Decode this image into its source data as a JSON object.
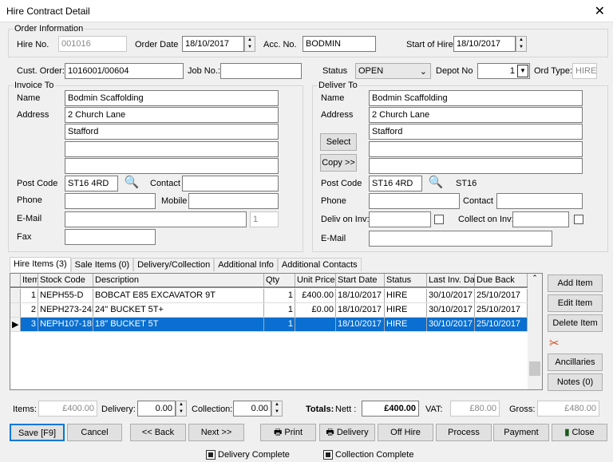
{
  "window": {
    "title": "Hire Contract Detail"
  },
  "order": {
    "group": "Order Information",
    "hire_no_label": "Hire No.",
    "hire_no": "001016",
    "order_date_label": "Order Date",
    "order_date": "18/10/2017",
    "acc_no_label": "Acc. No.",
    "acc_no": "BODMIN",
    "start_label": "Start of Hire",
    "start": "18/10/2017"
  },
  "cust": {
    "label": "Cust. Order:",
    "value": "1016001/00604",
    "job_label": "Job No.:",
    "job": ""
  },
  "status": {
    "label": "Status",
    "value": "OPEN",
    "depot_label": "Depot No",
    "depot": "1",
    "ord_type_label": "Ord Type:",
    "ord_type": "HIRE"
  },
  "invoice": {
    "group": "Invoice To",
    "name_label": "Name",
    "name": "Bodmin Scaffolding",
    "address_label": "Address",
    "address": [
      "2 Church Lane",
      "Stafford",
      "",
      ""
    ],
    "postcode_label": "Post Code",
    "postcode": "ST16 4RD",
    "contact_label": "Contact",
    "contact": "",
    "phone_label": "Phone",
    "phone": "",
    "mobile_label": "Mobile",
    "mobile": "",
    "email_label": "E-Mail",
    "email": "",
    "email_count": "1",
    "fax_label": "Fax",
    "fax": ""
  },
  "deliver": {
    "group": "Deliver To",
    "name_label": "Name",
    "name": "Bodmin Scaffolding",
    "address_label": "Address",
    "address": [
      "2 Church Lane",
      "Stafford",
      "",
      ""
    ],
    "select": "Select",
    "copy": "Copy >>",
    "postcode_label": "Post Code",
    "postcode": "ST16 4RD",
    "postcode_area": "ST16",
    "phone_label": "Phone",
    "contact_label": "Contact",
    "deliv_inv_label": "Deliv on Inv:",
    "collect_inv_label": "Collect on Inv:",
    "email_label": "E-Mail"
  },
  "tabs": [
    "Hire Items (3)",
    "Sale Items (0)",
    "Delivery/Collection",
    "Additional Info",
    "Additional Contacts"
  ],
  "grid": {
    "columns": [
      "Item",
      "Stock Code",
      "Description",
      "Qty",
      "Unit Price",
      "Start Date",
      "Status",
      "Last Inv. Da",
      "Due Back"
    ],
    "rows": [
      [
        "1",
        "NEPH55-D",
        "BOBCAT E85  EXCAVATOR 9T",
        "1",
        "£400.00",
        "18/10/2017",
        "HIRE",
        "30/10/2017",
        "25/10/2017"
      ],
      [
        "2",
        "NEPH273-24B",
        "24\" BUCKET 5T+",
        "1",
        "£0.00",
        "18/10/2017",
        "HIRE",
        "30/10/2017",
        "25/10/2017"
      ],
      [
        "3",
        "NEPH107-18B",
        "18\" BUCKET 5T",
        "1",
        "",
        "18/10/2017",
        "HIRE",
        "30/10/2017",
        "25/10/2017"
      ]
    ]
  },
  "side": {
    "add": "Add Item",
    "edit": "Edit Item",
    "delete": "Delete Item",
    "ancillaries": "Ancillaries",
    "notes": "Notes (0)"
  },
  "totals": {
    "items_label": "Items:",
    "items": "£400.00",
    "delivery_label": "Delivery:",
    "delivery": "0.00",
    "collection_label": "Collection:",
    "collection": "0.00",
    "totals_label": "Totals:",
    "nett_label": "Nett :",
    "nett": "£400.00",
    "vat_label": "VAT:",
    "vat": "£80.00",
    "gross_label": "Gross:",
    "gross": "£480.00"
  },
  "buttons": {
    "save": "Save [F9]",
    "cancel": "Cancel",
    "back": "<< Back",
    "next": "Next >>",
    "print": "Print",
    "delivery": "Delivery",
    "offhire": "Off Hire",
    "process": "Process",
    "payment": "Payment",
    "close": "Close"
  },
  "flags": {
    "delivery_complete": "Delivery Complete",
    "collection_complete": "Collection Complete"
  }
}
